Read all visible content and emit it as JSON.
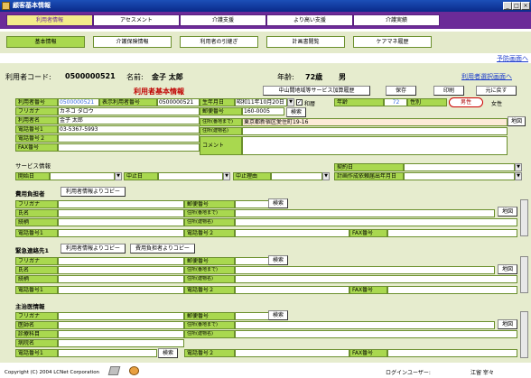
{
  "window": {
    "title": "顧客基本情報"
  },
  "nav1": [
    "利用者情報",
    "アセスメント",
    "介護支援",
    "より高い支援",
    "介護実績"
  ],
  "nav2": [
    "基本情報",
    "介護保険情報",
    "利用者の引継ぎ",
    "計画書閲覧",
    "ケアマネ履歴"
  ],
  "top_link": "予防画面へ",
  "header": {
    "code_label": "利用者コード:",
    "code_value": "0500000521",
    "name_label": "名前:",
    "name_value": "金子 太郎",
    "age_label": "年齢:",
    "age_value": "72歳",
    "sex_value": "男",
    "select_link": "利用者選択画面へ"
  },
  "basic": {
    "title": "利用者基本情報",
    "history_btn": "中山間地域等サービス加算履歴",
    "save_btn": "保存",
    "print_btn": "印刷",
    "back_btn": "元に戻す",
    "user_no_label": "利用者番号",
    "user_no_value": "0500000521",
    "display_no_label": "表示利用者番号",
    "display_no_value": "0500000521",
    "birth_label": "生年月日",
    "birth_value": "昭和11年10月20日",
    "era_label": "和暦",
    "age_label": "年齢",
    "age_value": "72",
    "sex_label": "性別",
    "male_label": "男性",
    "female_label": "女性",
    "kana_label": "フリガナ",
    "kana_value": "カネコ タロウ",
    "zip_label": "郵便番号",
    "zip_value": "160-0005",
    "search_btn": "検索",
    "name_label": "利用者名",
    "name_value": "金子 太郎",
    "addr1_label": "住所(番地まで)",
    "addr1_value": "東京都新宿区愛住町19-16",
    "tel1_label": "電話番号1",
    "tel1_value": "03-5367-5993",
    "addr2_label": "住所(建物名)",
    "map_btn": "地図",
    "tel2_label": "電話番号２",
    "comment_label": "コメント",
    "fax_label": "FAX番号"
  },
  "service": {
    "title": "サービス情報",
    "start_label": "開始日",
    "stop_label": "中止日",
    "stop_reason_label": "中止理由",
    "contract_label": "契約日",
    "plan_label": "計画作成依頼届出年月日"
  },
  "payer": {
    "title": "費用負担者",
    "copy_btn": "利用者情報よりコピー",
    "kana_label": "フリガナ",
    "zip_label": "郵便番号",
    "search_btn": "検索",
    "name_label": "氏名",
    "addr1_label": "住所(番地まで)",
    "map_btn": "地図",
    "rel_label": "続柄",
    "addr2_label": "住所(建物名)",
    "tel1_label": "電話番号1",
    "tel2_label": "電話番号２",
    "fax_label": "FAX番号"
  },
  "emergency": {
    "title": "緊急連絡先1",
    "copy_btn": "利用者情報よりコピー",
    "copy_btn2": "費用負担者よりコピー",
    "kana_label": "フリガナ",
    "zip_label": "郵便番号",
    "search_btn": "検索",
    "name_label": "氏名",
    "addr1_label": "住所(番地まで)",
    "map_btn": "地図",
    "rel_label": "続柄",
    "addr2_label": "住所(建物名)",
    "tel1_label": "電話番号1",
    "tel2_label": "電話番号２",
    "fax_label": "FAX番号"
  },
  "doctor": {
    "title": "主治医情報",
    "kana_label": "フリガナ",
    "zip_label": "郵便番号",
    "search_btn": "検索",
    "name_label": "医師名",
    "addr1_label": "住所(番地まで)",
    "map_btn": "地図",
    "clinic_label": "診療科目",
    "addr2_label": "住所(建物名)",
    "hospital_label": "病院名",
    "tel1_label": "電話番号1",
    "search_btn2": "検索",
    "tel2_label": "電話番号２",
    "fax_label": "FAX番号"
  },
  "footer": {
    "copyright": "Copyright (C) 2004 LCNet Corporation",
    "login_label": "ログインユーザー:",
    "login_user": "江留 宰々"
  }
}
